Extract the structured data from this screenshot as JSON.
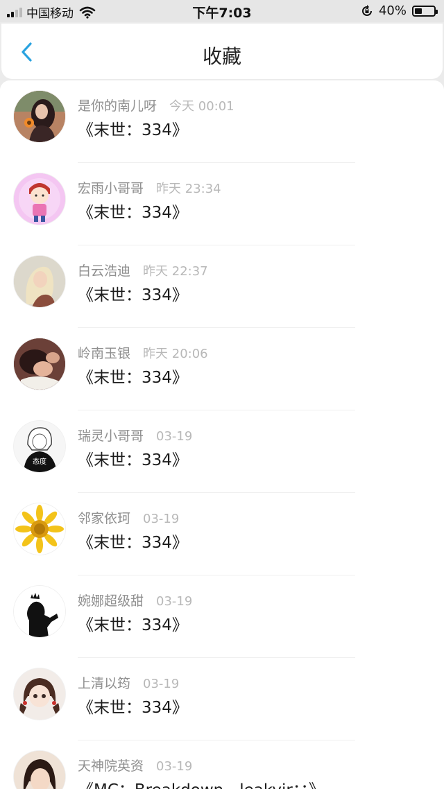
{
  "status_bar": {
    "carrier": "中国移动",
    "time": "下午7:03",
    "battery": "40%",
    "battery_level": 0.4
  },
  "nav": {
    "title": "收藏",
    "back_icon": "chevron-left-icon",
    "accent_color": "#2aa3e0"
  },
  "items": [
    {
      "name": "是你的南儿呀",
      "time": "今天 00:01",
      "book": "《末世：334》",
      "avatar_bg": "#c58a63"
    },
    {
      "name": "宏雨小哥哥",
      "time": "昨天 23:34",
      "book": "《末世：334》",
      "avatar_bg": "#f0b3ef"
    },
    {
      "name": "白云浩迪",
      "time": "昨天 22:37",
      "book": "《末世：334》",
      "avatar_bg": "#d9d4c4"
    },
    {
      "name": "岭南玉银",
      "time": "昨天 20:06",
      "book": "《末世：334》",
      "avatar_bg": "#7a4a3c"
    },
    {
      "name": "瑞灵小哥哥",
      "time": "03-19",
      "book": "《末世：334》",
      "avatar_bg": "#f4f4f4"
    },
    {
      "name": "邻家依珂",
      "time": "03-19",
      "book": "《末世：334》",
      "avatar_bg": "#ffffff"
    },
    {
      "name": "婉娜超级甜",
      "time": "03-19",
      "book": "《末世：334》",
      "avatar_bg": "#ffffff"
    },
    {
      "name": "上清以筠",
      "time": "03-19",
      "book": "《末世：334》",
      "avatar_bg": "#f1ece8"
    },
    {
      "name": "天神院英资",
      "time": "03-19",
      "book": "《MC：Breakdown，leakyir：：》",
      "avatar_bg": "#ead8c8"
    }
  ]
}
